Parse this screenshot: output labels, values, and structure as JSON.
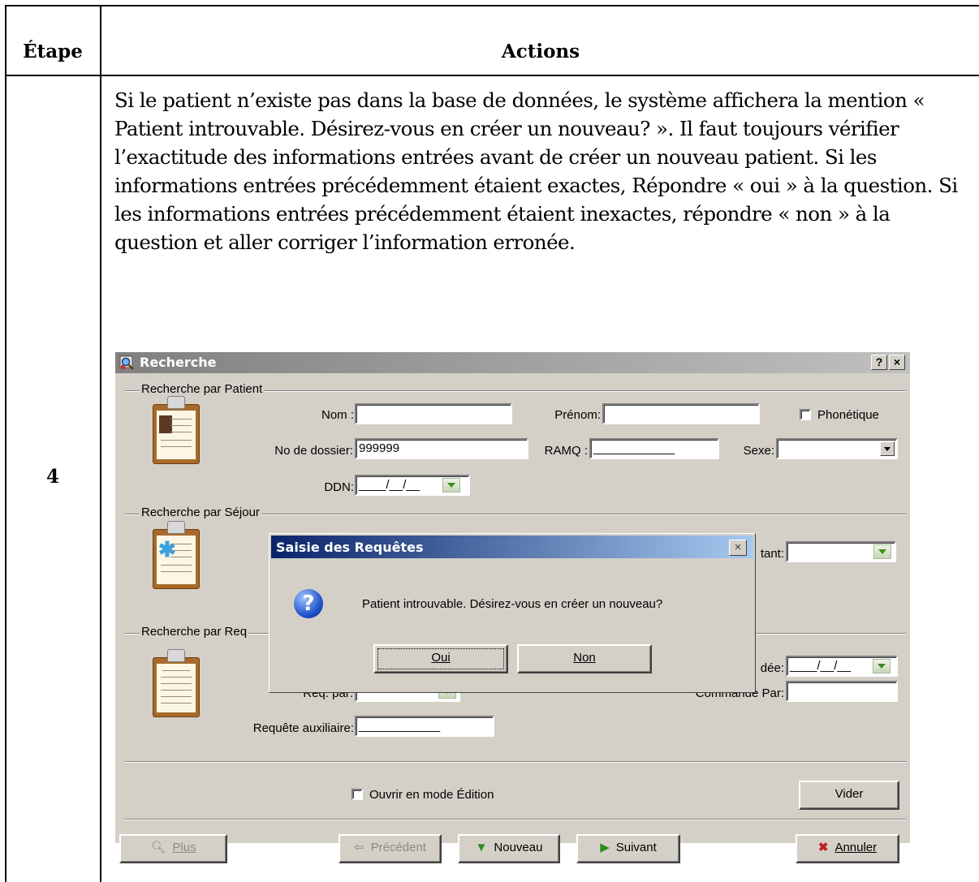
{
  "table": {
    "header_step": "Étape",
    "header_actions": "Actions",
    "step_number": "4",
    "instruction": "Si le patient n’existe pas dans la base de données, le système affichera la mention « Patient introuvable. Désirez-vous en créer un nouveau? ». Il faut toujours vérifier l’exactitude des informations entrées avant de créer un nouveau patient. Si les informations entrées précédemment étaient exactes, Répondre « oui » à la question. Si les informations entrées précédemment étaient inexactes, répondre « non » à la question et aller corriger l’information erronée."
  },
  "window": {
    "title": "Recherche",
    "help_button": "?",
    "close_button": "×",
    "group_patient": {
      "label": "Recherche par Patient",
      "nom_label": "Nom :",
      "nom_value": "",
      "prenom_label": "Prénom:",
      "prenom_value": "",
      "phonetique_label": "Phonétique",
      "dossier_label": "No de dossier:",
      "dossier_value": "999999",
      "ramq_label": "RAMQ :",
      "ramq_value": "____________",
      "sexe_label": "Sexe:",
      "sexe_value": "",
      "ddn_label": "DDN:",
      "ddn_value": "____/__/__"
    },
    "group_sejour": {
      "label": "Recherche par Séjour",
      "traitant_label": "tant:",
      "traitant_value": ""
    },
    "group_requete": {
      "label": "Recherche par Req",
      "demandee_label": "dée:",
      "demandee_value": "____/__/__",
      "req_par_label": "Req. par:",
      "commande_label": "Commande Par:",
      "commande_value": "",
      "auxiliaire_label": "Requête auxiliaire:",
      "auxiliaire_value": "____________"
    },
    "edit_mode_label": "Ouvrir en mode Édition",
    "buttons": {
      "vider": "Vider",
      "plus": "Plus",
      "precedent": "Précédent",
      "nouveau": "Nouveau",
      "suivant": "Suivant",
      "annuler": "Annuler"
    }
  },
  "dialog": {
    "title": "Saisie des Requêtes",
    "close": "×",
    "icon": "question-icon",
    "message": "Patient introuvable. Désirez-vous en créer un nouveau?",
    "yes": "Oui",
    "no": "Non"
  },
  "colors": {
    "dialog_title_start": "#0a246a",
    "dialog_title_end": "#a6caf0",
    "window_bg": "#d4d0c8"
  }
}
